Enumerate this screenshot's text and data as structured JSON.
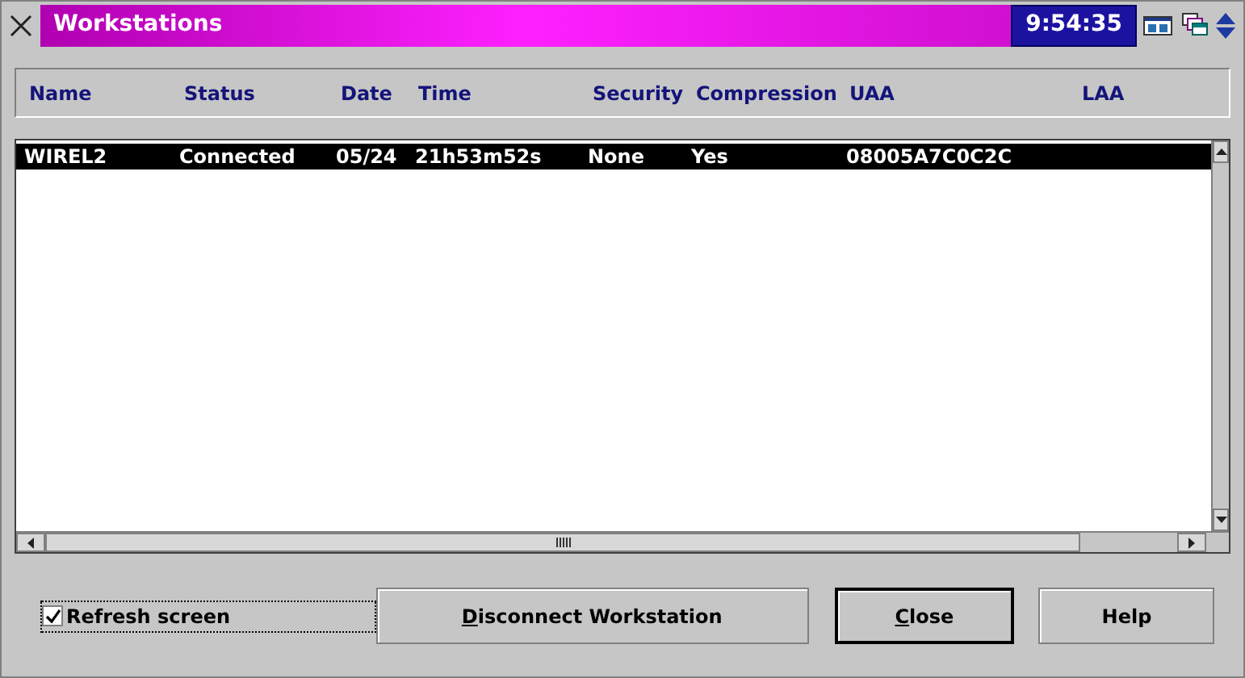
{
  "window": {
    "title": "Workstations",
    "clock": "9:54:35"
  },
  "table": {
    "columns": [
      "Name",
      "Status",
      "Date",
      "Time",
      "Security",
      "Compression",
      "UAA",
      "LAA"
    ],
    "rows": [
      {
        "cells": [
          "WIREL2",
          "Connected",
          "05/24",
          "21h53m52s",
          "None",
          "Yes",
          "08005A7C0C2C",
          ""
        ],
        "selected": true
      }
    ]
  },
  "refresh_checkbox": {
    "label": "Refresh screen",
    "checked": true
  },
  "buttons": [
    {
      "label": "Disconnect Workstation",
      "mnemonic": true,
      "default": false
    },
    {
      "label": "Close",
      "mnemonic": true,
      "default": true
    },
    {
      "label": "Help",
      "mnemonic": false,
      "default": false
    }
  ]
}
